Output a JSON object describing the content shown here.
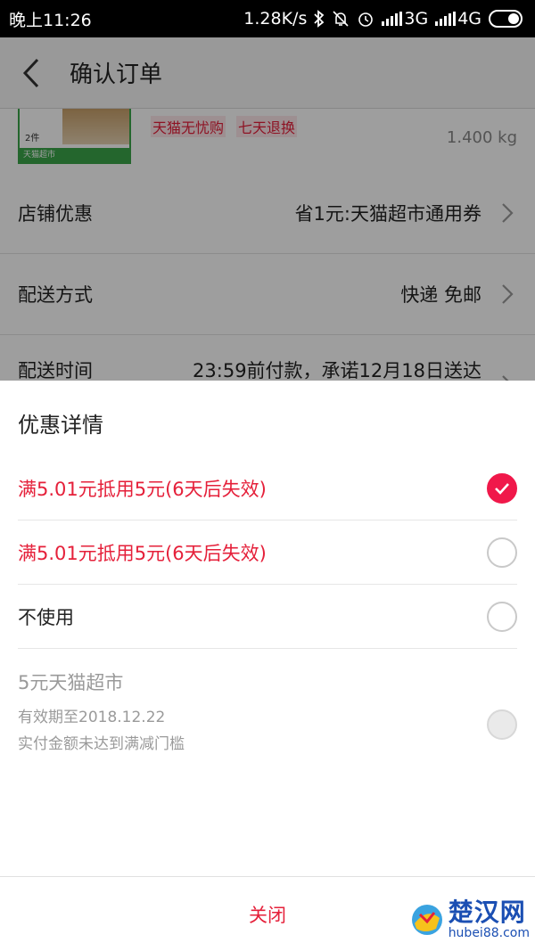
{
  "status_bar": {
    "time": "晚上11:26",
    "speed": "1.28K/s",
    "net1": "3G",
    "net2": "4G"
  },
  "header": {
    "title": "确认订单"
  },
  "product": {
    "thumb_qty": "2件",
    "thumb_brand": "天猫超市",
    "tags": [
      "天猫无忧购",
      "七天退换"
    ],
    "weight": "1.400 kg"
  },
  "order_rows": [
    {
      "label": "店铺优惠",
      "value": "省1元:天猫超市通用券"
    },
    {
      "label": "配送方式",
      "value": "快递 免邮"
    },
    {
      "label": "配送时间",
      "value": "23:59前付款，承诺12月18日送达"
    }
  ],
  "sheet": {
    "title": "优惠详情",
    "options": [
      {
        "label": "满5.01元抵用5元(6天后失效)",
        "state": "checked",
        "color": "red"
      },
      {
        "label": "满5.01元抵用5元(6天后失效)",
        "state": "unchecked",
        "color": "red"
      },
      {
        "label": "不使用",
        "state": "unchecked",
        "color": "dark"
      }
    ],
    "disabled_coupon": {
      "title": "5元天猫超市",
      "validity": "有效期至2018.12.22",
      "reason": "实付金额未达到满减门槛"
    },
    "close_label": "关闭"
  },
  "watermark": {
    "name": "楚汉网",
    "url": "hubei88.com"
  },
  "colors": {
    "accent": "#e5203a",
    "check": "#f0184a",
    "disabled": "#9a9a9a"
  },
  "icons": [
    "back-arrow-icon",
    "bluetooth-icon",
    "mute-icon",
    "alarm-icon",
    "signal-icon",
    "battery-toggle-icon",
    "chevron-right-icon",
    "checkmark-icon"
  ]
}
